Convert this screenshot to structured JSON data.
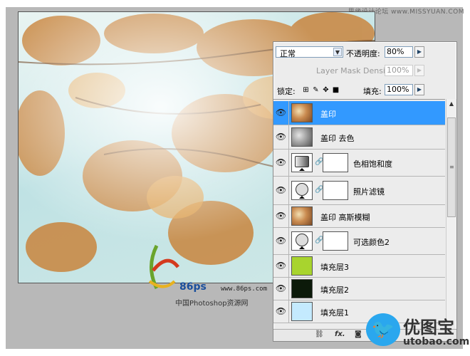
{
  "site_tag": "思缘设计论坛 www.MISSYUAN.COM",
  "watermark": {
    "url": "www.86ps.com",
    "caption": "中国Photoshop资源网",
    "logo_text": "86ps"
  },
  "panel": {
    "blend_mode": "正常",
    "opacity_label": "不透明度:",
    "opacity_value": "80%",
    "mask_density_label": "Layer Mask Density",
    "mask_density_value": "100%",
    "lock_label": "锁定:",
    "fill_label": "填充:",
    "fill_value": "100%"
  },
  "layers": [
    {
      "name": "盖印",
      "selected": true
    },
    {
      "name": "盖印 去色"
    },
    {
      "name": "色相饱和度"
    },
    {
      "name": "照片滤镜"
    },
    {
      "name": "盖印 高斯模糊"
    },
    {
      "name": "可选颜色2"
    },
    {
      "name": "填充层3",
      "color": "#a8d42e"
    },
    {
      "name": "填充层2",
      "color": "#0c1a0a"
    },
    {
      "name": "填充层1",
      "color": "#c4eafe"
    }
  ],
  "bottom_icons": [
    "link-icon",
    "fx-icon",
    "mask-icon"
  ],
  "brand": {
    "name": "优图宝",
    "url": "utobao.com"
  }
}
